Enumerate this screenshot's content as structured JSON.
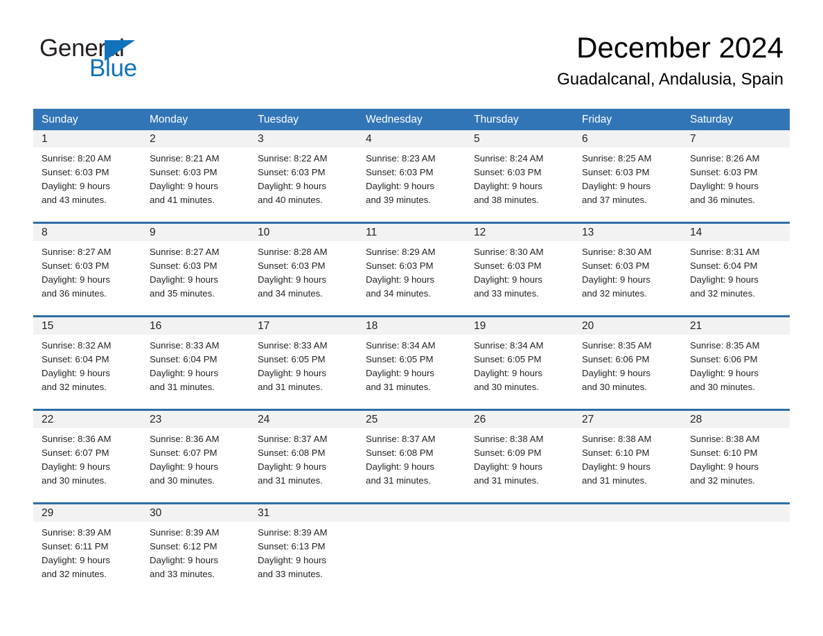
{
  "brand": {
    "logo_text_primary": "General",
    "logo_text_secondary": "Blue",
    "logo_triangle_color": "#1072ba",
    "logo_primary_color": "#231f20"
  },
  "header": {
    "month_title": "December 2024",
    "location": "Guadalcanal, Andalusia, Spain"
  },
  "theme": {
    "header_bg": "#3275b7",
    "header_text": "#ffffff",
    "row_divider": "#2e6da4",
    "day_band_bg": "#f2f2f2",
    "cell_bg": "#ffffff",
    "body_text": "#231f20"
  },
  "weekdays": [
    "Sunday",
    "Monday",
    "Tuesday",
    "Wednesday",
    "Thursday",
    "Friday",
    "Saturday"
  ],
  "labels": {
    "sunrise_prefix": "Sunrise:",
    "sunset_prefix": "Sunset:",
    "daylight_prefix": "Daylight:"
  },
  "weeks": [
    {
      "days": [
        {
          "day": "1",
          "sunrise": "Sunrise: 8:20 AM",
          "sunset": "Sunset: 6:03 PM",
          "daylight_line1": "Daylight: 9 hours",
          "daylight_line2": "and 43 minutes."
        },
        {
          "day": "2",
          "sunrise": "Sunrise: 8:21 AM",
          "sunset": "Sunset: 6:03 PM",
          "daylight_line1": "Daylight: 9 hours",
          "daylight_line2": "and 41 minutes."
        },
        {
          "day": "3",
          "sunrise": "Sunrise: 8:22 AM",
          "sunset": "Sunset: 6:03 PM",
          "daylight_line1": "Daylight: 9 hours",
          "daylight_line2": "and 40 minutes."
        },
        {
          "day": "4",
          "sunrise": "Sunrise: 8:23 AM",
          "sunset": "Sunset: 6:03 PM",
          "daylight_line1": "Daylight: 9 hours",
          "daylight_line2": "and 39 minutes."
        },
        {
          "day": "5",
          "sunrise": "Sunrise: 8:24 AM",
          "sunset": "Sunset: 6:03 PM",
          "daylight_line1": "Daylight: 9 hours",
          "daylight_line2": "and 38 minutes."
        },
        {
          "day": "6",
          "sunrise": "Sunrise: 8:25 AM",
          "sunset": "Sunset: 6:03 PM",
          "daylight_line1": "Daylight: 9 hours",
          "daylight_line2": "and 37 minutes."
        },
        {
          "day": "7",
          "sunrise": "Sunrise: 8:26 AM",
          "sunset": "Sunset: 6:03 PM",
          "daylight_line1": "Daylight: 9 hours",
          "daylight_line2": "and 36 minutes."
        }
      ]
    },
    {
      "days": [
        {
          "day": "8",
          "sunrise": "Sunrise: 8:27 AM",
          "sunset": "Sunset: 6:03 PM",
          "daylight_line1": "Daylight: 9 hours",
          "daylight_line2": "and 36 minutes."
        },
        {
          "day": "9",
          "sunrise": "Sunrise: 8:27 AM",
          "sunset": "Sunset: 6:03 PM",
          "daylight_line1": "Daylight: 9 hours",
          "daylight_line2": "and 35 minutes."
        },
        {
          "day": "10",
          "sunrise": "Sunrise: 8:28 AM",
          "sunset": "Sunset: 6:03 PM",
          "daylight_line1": "Daylight: 9 hours",
          "daylight_line2": "and 34 minutes."
        },
        {
          "day": "11",
          "sunrise": "Sunrise: 8:29 AM",
          "sunset": "Sunset: 6:03 PM",
          "daylight_line1": "Daylight: 9 hours",
          "daylight_line2": "and 34 minutes."
        },
        {
          "day": "12",
          "sunrise": "Sunrise: 8:30 AM",
          "sunset": "Sunset: 6:03 PM",
          "daylight_line1": "Daylight: 9 hours",
          "daylight_line2": "and 33 minutes."
        },
        {
          "day": "13",
          "sunrise": "Sunrise: 8:30 AM",
          "sunset": "Sunset: 6:03 PM",
          "daylight_line1": "Daylight: 9 hours",
          "daylight_line2": "and 32 minutes."
        },
        {
          "day": "14",
          "sunrise": "Sunrise: 8:31 AM",
          "sunset": "Sunset: 6:04 PM",
          "daylight_line1": "Daylight: 9 hours",
          "daylight_line2": "and 32 minutes."
        }
      ]
    },
    {
      "days": [
        {
          "day": "15",
          "sunrise": "Sunrise: 8:32 AM",
          "sunset": "Sunset: 6:04 PM",
          "daylight_line1": "Daylight: 9 hours",
          "daylight_line2": "and 32 minutes."
        },
        {
          "day": "16",
          "sunrise": "Sunrise: 8:33 AM",
          "sunset": "Sunset: 6:04 PM",
          "daylight_line1": "Daylight: 9 hours",
          "daylight_line2": "and 31 minutes."
        },
        {
          "day": "17",
          "sunrise": "Sunrise: 8:33 AM",
          "sunset": "Sunset: 6:05 PM",
          "daylight_line1": "Daylight: 9 hours",
          "daylight_line2": "and 31 minutes."
        },
        {
          "day": "18",
          "sunrise": "Sunrise: 8:34 AM",
          "sunset": "Sunset: 6:05 PM",
          "daylight_line1": "Daylight: 9 hours",
          "daylight_line2": "and 31 minutes."
        },
        {
          "day": "19",
          "sunrise": "Sunrise: 8:34 AM",
          "sunset": "Sunset: 6:05 PM",
          "daylight_line1": "Daylight: 9 hours",
          "daylight_line2": "and 30 minutes."
        },
        {
          "day": "20",
          "sunrise": "Sunrise: 8:35 AM",
          "sunset": "Sunset: 6:06 PM",
          "daylight_line1": "Daylight: 9 hours",
          "daylight_line2": "and 30 minutes."
        },
        {
          "day": "21",
          "sunrise": "Sunrise: 8:35 AM",
          "sunset": "Sunset: 6:06 PM",
          "daylight_line1": "Daylight: 9 hours",
          "daylight_line2": "and 30 minutes."
        }
      ]
    },
    {
      "days": [
        {
          "day": "22",
          "sunrise": "Sunrise: 8:36 AM",
          "sunset": "Sunset: 6:07 PM",
          "daylight_line1": "Daylight: 9 hours",
          "daylight_line2": "and 30 minutes."
        },
        {
          "day": "23",
          "sunrise": "Sunrise: 8:36 AM",
          "sunset": "Sunset: 6:07 PM",
          "daylight_line1": "Daylight: 9 hours",
          "daylight_line2": "and 30 minutes."
        },
        {
          "day": "24",
          "sunrise": "Sunrise: 8:37 AM",
          "sunset": "Sunset: 6:08 PM",
          "daylight_line1": "Daylight: 9 hours",
          "daylight_line2": "and 31 minutes."
        },
        {
          "day": "25",
          "sunrise": "Sunrise: 8:37 AM",
          "sunset": "Sunset: 6:08 PM",
          "daylight_line1": "Daylight: 9 hours",
          "daylight_line2": "and 31 minutes."
        },
        {
          "day": "26",
          "sunrise": "Sunrise: 8:38 AM",
          "sunset": "Sunset: 6:09 PM",
          "daylight_line1": "Daylight: 9 hours",
          "daylight_line2": "and 31 minutes."
        },
        {
          "day": "27",
          "sunrise": "Sunrise: 8:38 AM",
          "sunset": "Sunset: 6:10 PM",
          "daylight_line1": "Daylight: 9 hours",
          "daylight_line2": "and 31 minutes."
        },
        {
          "day": "28",
          "sunrise": "Sunrise: 8:38 AM",
          "sunset": "Sunset: 6:10 PM",
          "daylight_line1": "Daylight: 9 hours",
          "daylight_line2": "and 32 minutes."
        }
      ]
    },
    {
      "days": [
        {
          "day": "29",
          "sunrise": "Sunrise: 8:39 AM",
          "sunset": "Sunset: 6:11 PM",
          "daylight_line1": "Daylight: 9 hours",
          "daylight_line2": "and 32 minutes."
        },
        {
          "day": "30",
          "sunrise": "Sunrise: 8:39 AM",
          "sunset": "Sunset: 6:12 PM",
          "daylight_line1": "Daylight: 9 hours",
          "daylight_line2": "and 33 minutes."
        },
        {
          "day": "31",
          "sunrise": "Sunrise: 8:39 AM",
          "sunset": "Sunset: 6:13 PM",
          "daylight_line1": "Daylight: 9 hours",
          "daylight_line2": "and 33 minutes."
        },
        {
          "day": "",
          "sunrise": "",
          "sunset": "",
          "daylight_line1": "",
          "daylight_line2": ""
        },
        {
          "day": "",
          "sunrise": "",
          "sunset": "",
          "daylight_line1": "",
          "daylight_line2": ""
        },
        {
          "day": "",
          "sunrise": "",
          "sunset": "",
          "daylight_line1": "",
          "daylight_line2": ""
        },
        {
          "day": "",
          "sunrise": "",
          "sunset": "",
          "daylight_line1": "",
          "daylight_line2": ""
        }
      ]
    }
  ]
}
